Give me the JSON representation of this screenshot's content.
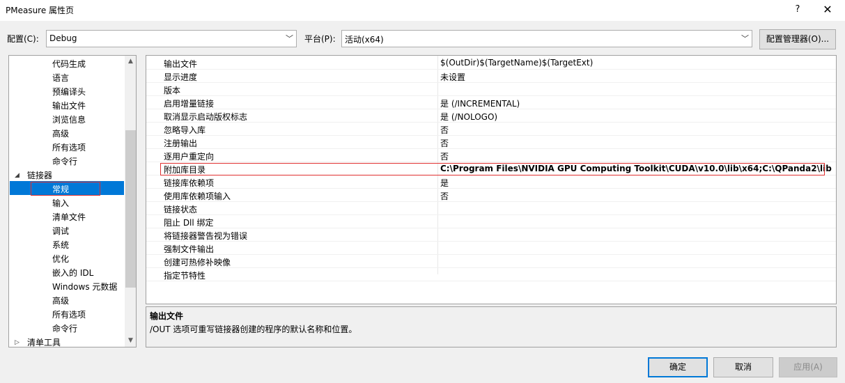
{
  "window": {
    "title": "PMeasure 属性页",
    "help_label": "?",
    "close_label": "✕"
  },
  "config": {
    "config_label": "配置(C):",
    "config_value": "Debug",
    "platform_label": "平台(P):",
    "platform_value": "活动(x64)",
    "manager_button": "配置管理器(O)..."
  },
  "tree": {
    "items": [
      {
        "label": "代码生成",
        "level": 2
      },
      {
        "label": "语言",
        "level": 2
      },
      {
        "label": "预编译头",
        "level": 2
      },
      {
        "label": "输出文件",
        "level": 2
      },
      {
        "label": "浏览信息",
        "level": 2
      },
      {
        "label": "高级",
        "level": 2
      },
      {
        "label": "所有选项",
        "level": 2
      },
      {
        "label": "命令行",
        "level": 2
      },
      {
        "label": "链接器",
        "level": 1,
        "expander": "◢"
      },
      {
        "label": "常规",
        "level": 2,
        "selected": true
      },
      {
        "label": "输入",
        "level": 2
      },
      {
        "label": "清单文件",
        "level": 2
      },
      {
        "label": "调试",
        "level": 2
      },
      {
        "label": "系统",
        "level": 2
      },
      {
        "label": "优化",
        "level": 2
      },
      {
        "label": "嵌入的 IDL",
        "level": 2
      },
      {
        "label": "Windows 元数据",
        "level": 2
      },
      {
        "label": "高级",
        "level": 2
      },
      {
        "label": "所有选项",
        "level": 2
      },
      {
        "label": "命令行",
        "level": 2
      },
      {
        "label": "清单工具",
        "level": 1,
        "expander": "▷"
      }
    ]
  },
  "properties": {
    "rows": [
      {
        "name": "输出文件",
        "value": "$(OutDir)$(TargetName)$(TargetExt)"
      },
      {
        "name": "显示进度",
        "value": "未设置"
      },
      {
        "name": "版本",
        "value": ""
      },
      {
        "name": "启用增量链接",
        "value": "是 (/INCREMENTAL)"
      },
      {
        "name": "取消显示启动版权标志",
        "value": "是 (/NOLOGO)"
      },
      {
        "name": "忽略导入库",
        "value": "否"
      },
      {
        "name": "注册输出",
        "value": "否"
      },
      {
        "name": "逐用户重定向",
        "value": "否"
      },
      {
        "name": "附加库目录",
        "value": "C:\\Program Files\\NVIDIA GPU Computing Toolkit\\CUDA\\v10.0\\lib\\x64;C:\\QPanda2\\lib",
        "bold": true
      },
      {
        "name": "链接库依赖项",
        "value": "是"
      },
      {
        "name": "使用库依赖项输入",
        "value": "否"
      },
      {
        "name": "链接状态",
        "value": ""
      },
      {
        "name": "阻止 Dll 绑定",
        "value": ""
      },
      {
        "name": "将链接器警告视为错误",
        "value": ""
      },
      {
        "name": "强制文件输出",
        "value": ""
      },
      {
        "name": "创建可热修补映像",
        "value": ""
      },
      {
        "name": "指定节特性",
        "value": ""
      }
    ]
  },
  "description": {
    "title": "输出文件",
    "text": "/OUT 选项可重写链接器创建的程序的默认名称和位置。"
  },
  "buttons": {
    "ok": "确定",
    "cancel": "取消",
    "apply": "应用(A)"
  },
  "colors": {
    "selection": "#0078d7",
    "highlight_border": "#e03030"
  }
}
